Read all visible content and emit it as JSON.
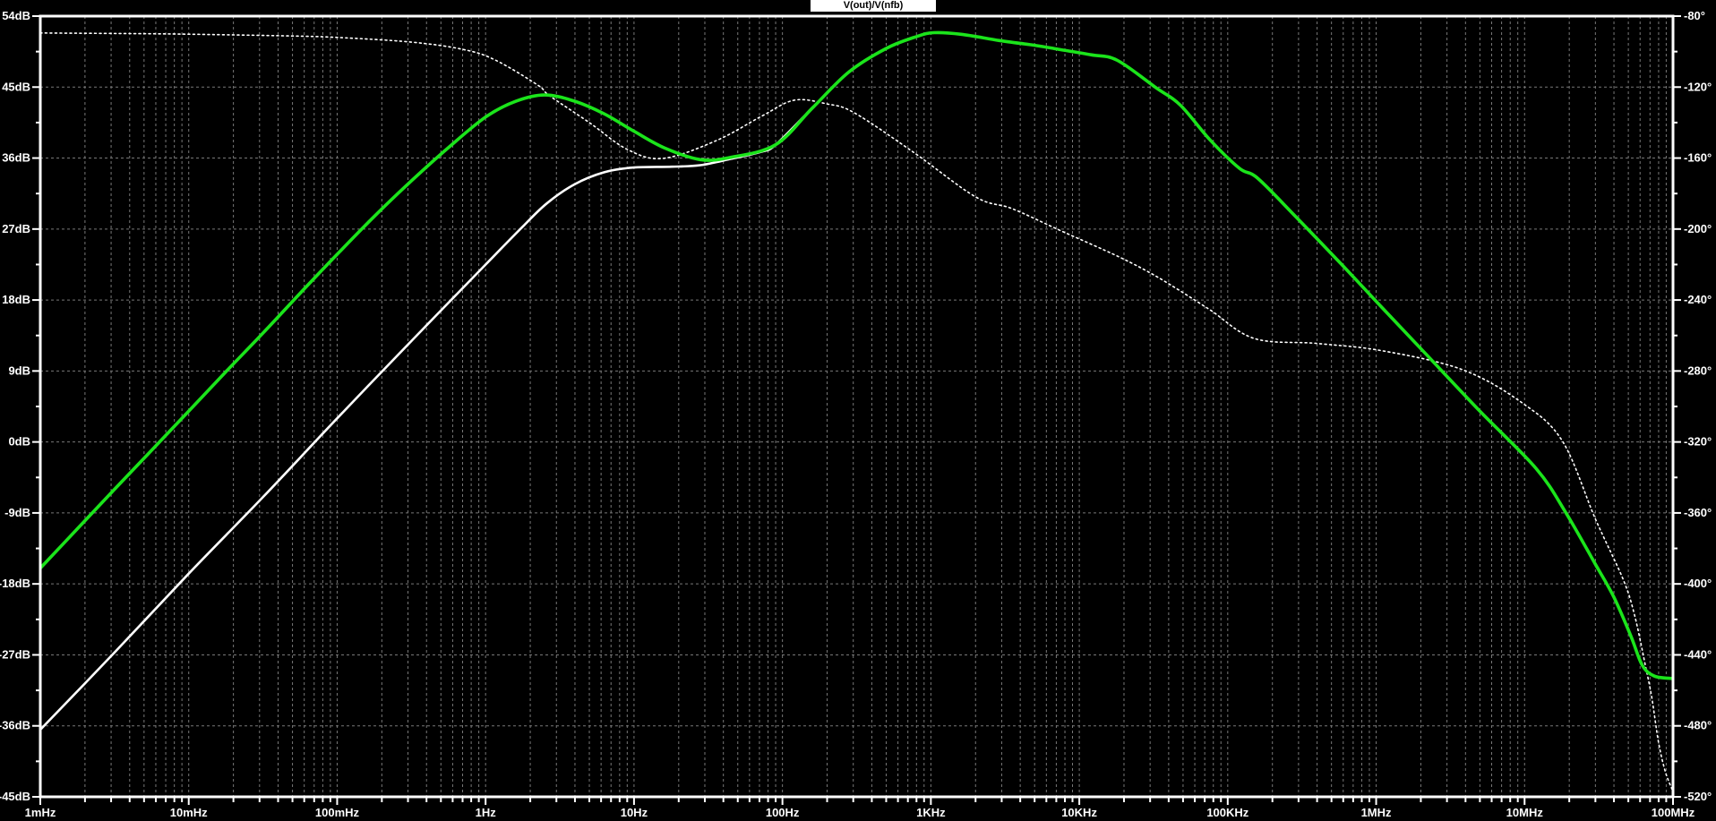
{
  "title": "V(out)/V(nfb)",
  "colors": {
    "background": "#000000",
    "grid": "#787878",
    "axis": "#ffffff",
    "title_bg": "#ffffff",
    "title_fg": "#000000",
    "trace_green": "#1be41b",
    "trace_white": "#ffffff"
  },
  "chart_data": {
    "type": "line",
    "title": "V(out)/V(nfb)",
    "grid": "on",
    "x_axis": {
      "scale": "log",
      "min_hz": 0.001,
      "max_hz": 100000000,
      "decade_labels": [
        {
          "hz": 0.001,
          "label": "1mHz"
        },
        {
          "hz": 0.01,
          "label": "10mHz"
        },
        {
          "hz": 0.1,
          "label": "100mHz"
        },
        {
          "hz": 1,
          "label": "1Hz"
        },
        {
          "hz": 10,
          "label": "10Hz"
        },
        {
          "hz": 100,
          "label": "100Hz"
        },
        {
          "hz": 1000,
          "label": "1KHz"
        },
        {
          "hz": 10000,
          "label": "10KHz"
        },
        {
          "hz": 100000,
          "label": "100KHz"
        },
        {
          "hz": 1000000,
          "label": "1MHz"
        },
        {
          "hz": 10000000,
          "label": "10MHz"
        },
        {
          "hz": 100000000,
          "label": "100MHz"
        }
      ]
    },
    "y_left_axis": {
      "unit": "dB",
      "max": 54,
      "min": -45,
      "step": 9,
      "labels": [
        {
          "value": 54,
          "label": "54dB"
        },
        {
          "value": 45,
          "label": "45dB"
        },
        {
          "value": 36,
          "label": "36dB"
        },
        {
          "value": 27,
          "label": "27dB"
        },
        {
          "value": 18,
          "label": "18dB"
        },
        {
          "value": 9,
          "label": "9dB"
        },
        {
          "value": 0,
          "label": "0dB"
        },
        {
          "value": -9,
          "label": "-9dB"
        },
        {
          "value": -18,
          "label": "-18dB"
        },
        {
          "value": -27,
          "label": "-27dB"
        },
        {
          "value": -36,
          "label": "-36dB"
        },
        {
          "value": -45,
          "label": "-45dB"
        }
      ]
    },
    "y_right_axis": {
      "unit": "degrees",
      "max": -80,
      "min": -520,
      "step": 40,
      "labels": [
        {
          "value": -80,
          "label": "-80°"
        },
        {
          "value": -120,
          "label": "-120°"
        },
        {
          "value": -160,
          "label": "-160°"
        },
        {
          "value": -200,
          "label": "-200°"
        },
        {
          "value": -240,
          "label": "-240°"
        },
        {
          "value": -280,
          "label": "-280°"
        },
        {
          "value": -320,
          "label": "-320°"
        },
        {
          "value": -360,
          "label": "-360°"
        },
        {
          "value": -400,
          "label": "-400°"
        },
        {
          "value": -440,
          "label": "-440°"
        },
        {
          "value": -480,
          "label": "-480°"
        },
        {
          "value": -520,
          "label": "-520°"
        }
      ]
    },
    "series": [
      {
        "name": "magnitude-white",
        "color": "#ffffff",
        "style": "solid",
        "width": 2.6,
        "axis": "left",
        "points": [
          [
            0.001,
            -36.5
          ],
          [
            0.0032,
            -26.6
          ],
          [
            0.01,
            -16.7
          ],
          [
            0.032,
            -6.9
          ],
          [
            0.1,
            3.0
          ],
          [
            0.32,
            12.9
          ],
          [
            1,
            22.5
          ],
          [
            1.8,
            27.4
          ],
          [
            2.6,
            30.3
          ],
          [
            4,
            32.7
          ],
          [
            6.3,
            34.2
          ],
          [
            10,
            34.8
          ],
          [
            18,
            34.9
          ],
          [
            28,
            35.1
          ],
          [
            45,
            35.9
          ],
          [
            72,
            36.8
          ],
          [
            90,
            37.7
          ],
          [
            160,
            42.4
          ],
          [
            280,
            46.9
          ],
          [
            500,
            49.9
          ],
          [
            800,
            51.4
          ],
          [
            1050,
            51.9
          ],
          [
            1600,
            51.7
          ],
          [
            2900,
            50.9
          ],
          [
            5000,
            50.3
          ],
          [
            7200,
            49.8
          ],
          [
            12000,
            49.1
          ],
          [
            18000,
            48.4
          ],
          [
            33000,
            44.9
          ],
          [
            48000,
            42.7
          ],
          [
            76000,
            38.3
          ],
          [
            120000,
            34.7
          ],
          [
            160000,
            33.4
          ],
          [
            300000,
            28.2
          ],
          [
            600000,
            22.3
          ],
          [
            1100000,
            17.0
          ],
          [
            2200000,
            11.0
          ],
          [
            5000000,
            3.9
          ],
          [
            12000000,
            -3.4
          ],
          [
            19000000,
            -9.0
          ],
          [
            30000000,
            -15.5
          ],
          [
            40000000,
            -19.7
          ],
          [
            52000000,
            -24.6
          ],
          [
            62000000,
            -28.3
          ],
          [
            75000000,
            -29.7
          ],
          [
            100000000,
            -30.0
          ]
        ]
      },
      {
        "name": "phase-white",
        "color": "#ffffff",
        "style": "dotted",
        "width": 1.6,
        "axis": "right",
        "points": [
          [
            0.001,
            -89.5
          ],
          [
            0.005,
            -89.9
          ],
          [
            0.01,
            -90.2
          ],
          [
            0.05,
            -91.2
          ],
          [
            0.1,
            -92.0
          ],
          [
            0.31,
            -94.6
          ],
          [
            0.7,
            -98.7
          ],
          [
            1.16,
            -104.7
          ],
          [
            2.24,
            -118.8
          ],
          [
            2.7,
            -124.9
          ],
          [
            5,
            -140.0
          ],
          [
            9,
            -155.1
          ],
          [
            15.7,
            -160.2
          ],
          [
            36,
            -150.1
          ],
          [
            72,
            -136.5
          ],
          [
            120,
            -127.4
          ],
          [
            200,
            -129.5
          ],
          [
            305,
            -134.5
          ],
          [
            760,
            -156.6
          ],
          [
            2000,
            -181.9
          ],
          [
            3500,
            -188.4
          ],
          [
            7300,
            -200.5
          ],
          [
            18500,
            -215.7
          ],
          [
            34000,
            -227.3
          ],
          [
            74000,
            -244.9
          ],
          [
            150000,
            -261.6
          ],
          [
            400000,
            -264.5
          ],
          [
            1100000,
            -268.6
          ],
          [
            3800000,
            -279.2
          ],
          [
            9600000,
            -297.9
          ],
          [
            18000000,
            -319.6
          ],
          [
            30000000,
            -363.4
          ],
          [
            46000000,
            -397.2
          ],
          [
            55000000,
            -417.4
          ],
          [
            65000000,
            -445.6
          ],
          [
            72000000,
            -464.3
          ],
          [
            80000000,
            -489.5
          ],
          [
            89000000,
            -506.1
          ],
          [
            100000000,
            -517.0
          ]
        ]
      },
      {
        "name": "magnitude-green",
        "color": "#1be41b",
        "style": "solid",
        "width": 3.6,
        "axis": "left",
        "points": [
          [
            0.001,
            -16.0
          ],
          [
            0.0018,
            -10.9
          ],
          [
            0.0032,
            -5.9
          ],
          [
            0.0056,
            -1.1
          ],
          [
            0.01,
            3.9
          ],
          [
            0.018,
            9.0
          ],
          [
            0.032,
            13.9
          ],
          [
            0.056,
            18.8
          ],
          [
            0.1,
            23.8
          ],
          [
            0.18,
            28.7
          ],
          [
            0.32,
            33.2
          ],
          [
            0.56,
            37.3
          ],
          [
            1,
            41.2
          ],
          [
            1.6,
            43.2
          ],
          [
            2.5,
            44.0
          ],
          [
            4,
            43.2
          ],
          [
            6.3,
            41.6
          ],
          [
            10,
            39.4
          ],
          [
            16,
            37.3
          ],
          [
            28,
            35.8
          ],
          [
            45,
            36.1
          ],
          [
            90,
            37.7
          ],
          [
            160,
            42.4
          ],
          [
            280,
            46.9
          ],
          [
            500,
            49.9
          ],
          [
            800,
            51.4
          ],
          [
            1050,
            51.9
          ],
          [
            1600,
            51.7
          ],
          [
            2900,
            50.9
          ],
          [
            5000,
            50.3
          ],
          [
            7200,
            49.8
          ],
          [
            12000,
            49.1
          ],
          [
            18000,
            48.4
          ],
          [
            33000,
            44.9
          ],
          [
            48000,
            42.7
          ],
          [
            76000,
            38.3
          ],
          [
            120000,
            34.7
          ],
          [
            160000,
            33.4
          ],
          [
            300000,
            28.2
          ],
          [
            600000,
            22.3
          ],
          [
            1100000,
            17.0
          ],
          [
            2200000,
            11.0
          ],
          [
            5000000,
            3.9
          ],
          [
            12000000,
            -3.4
          ],
          [
            19000000,
            -9.0
          ],
          [
            30000000,
            -15.5
          ],
          [
            40000000,
            -19.7
          ],
          [
            52000000,
            -24.6
          ],
          [
            62000000,
            -28.3
          ],
          [
            75000000,
            -29.7
          ],
          [
            100000000,
            -30.0
          ]
        ]
      }
    ]
  }
}
